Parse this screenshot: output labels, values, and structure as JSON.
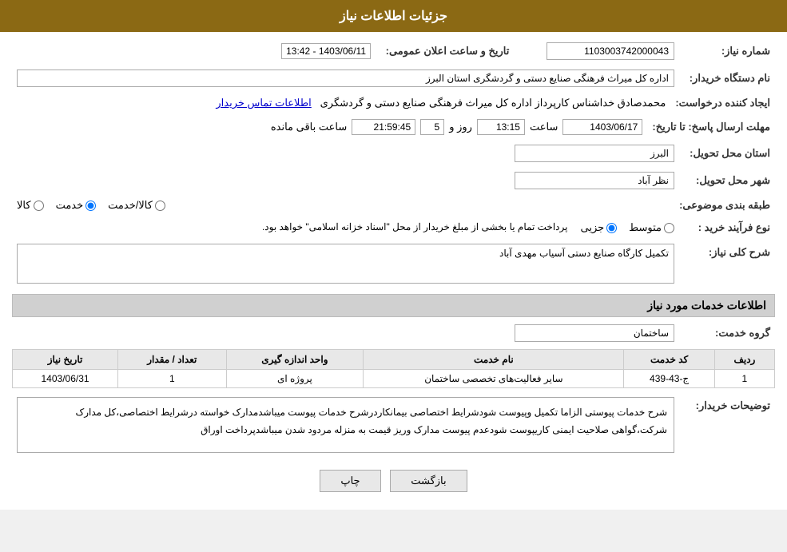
{
  "header": {
    "title": "جزئیات اطلاعات نیاز"
  },
  "fields": {
    "shomara_niaz_label": "شماره نیاز:",
    "shomara_niaz_value": "1103003742000043",
    "nam_dastgah_label": "نام دستگاه خریدار:",
    "nam_dastgah_value": "اداره کل میراث فرهنگی  صنایع دستی و گردشگری استان البرز",
    "ijad_konande_label": "ایجاد کننده درخواست:",
    "ijad_konande_value": "محمدصادق خداشناس  کارپرداز اداره کل میراث فرهنگی  صنایع دستی و گردشگری",
    "ettelaat_tamas_label": "اطلاعات تماس خریدار",
    "mohlat_ersal_label": "مهلت ارسال پاسخ: تا تاریخ:",
    "tarikh_elan_label": "تاریخ و ساعت اعلان عمومی:",
    "tarikh_elan_value": "1403/06/11 - 13:42",
    "tarikh_value": "1403/06/17",
    "saat_value": "13:15",
    "roz_value": "5",
    "saat_manande_value": "21:59:45",
    "saat_label": "ساعت",
    "roz_label": "روز و",
    "saat_manande_label": "ساعت باقی مانده",
    "ostan_tahvil_label": "استان محل تحویل:",
    "ostan_tahvil_value": "البرز",
    "shahr_tahvil_label": "شهر محل تحویل:",
    "shahr_tahvil_value": "نظر آباد",
    "tabaqe_label": "طبقه بندی موضوعی:",
    "navae_farayand_label": "نوع فرآیند خرید :",
    "tabaqe_options": [
      "کالا",
      "خدمت",
      "کالا/خدمت"
    ],
    "navae_options": [
      "جزیی",
      "متوسط"
    ],
    "navae_text": "پرداخت تمام یا بخشی از مبلغ خریدار از محل \"اسناد خزانه اسلامی\" خواهد بود.",
    "sharh_koli_label": "شرح کلی نیاز:",
    "sharh_koli_value": "تکمیل کارگاه صنایع دستی آسیاب مهدی آباد",
    "ettelaat_khadamat_title": "اطلاعات خدمات مورد نیاز",
    "gorohe_khadamat_label": "گروه خدمت:",
    "gorohe_khadamat_value": "ساختمان",
    "table": {
      "headers": [
        "ردیف",
        "کد خدمت",
        "نام خدمت",
        "واحد اندازه گیری",
        "تعداد / مقدار",
        "تاریخ نیاز"
      ],
      "rows": [
        {
          "radif": "1",
          "kod_khadamat": "ج-43-439",
          "nam_khadamat": "سایر فعالیت‌های تخصصی ساختمان",
          "vahed": "پروژه ای",
          "tedad": "1",
          "tarikh_niaz": "1403/06/31"
        }
      ]
    },
    "toseiat_label": "توضیحات خریدار:",
    "toseiat_value": "شرح خدمات پیوستی الزاما تکمیل وپیوست شودشرایط اختصاصی بیمانکاردرشرح خدمات پیوست میباشدمدارک خواسته درشرایط اختصاصی،کل مدارک شرکت،گواهی صلاحیت ایمنی کاریپوست شودعدم پیوست مدارک وریز قیمت به منزله مردود شدن میباشدپرداخت اوراق"
  },
  "buttons": {
    "print_label": "چاپ",
    "back_label": "بازگشت"
  }
}
